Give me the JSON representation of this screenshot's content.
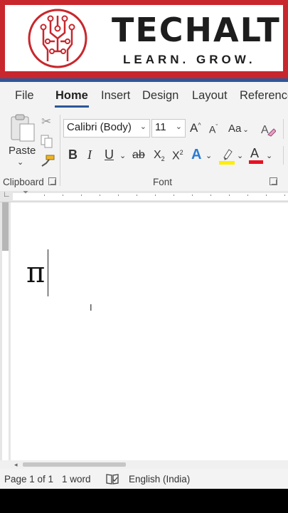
{
  "banner": {
    "brand_name": "TECHALT",
    "tagline": "LEARN. GROW.",
    "logo_icon": "circuit-head-icon",
    "brand_color": "#c8272d"
  },
  "ribbon": {
    "tabs": [
      {
        "label": "File",
        "active": false
      },
      {
        "label": "Home",
        "active": true
      },
      {
        "label": "Insert",
        "active": false
      },
      {
        "label": "Design",
        "active": false
      },
      {
        "label": "Layout",
        "active": false
      },
      {
        "label": "Reference",
        "active": false
      }
    ],
    "clipboard": {
      "paste_label": "Paste",
      "group_label": "Clipboard"
    },
    "font": {
      "font_name": "Calibri (Body)",
      "font_size": "11",
      "group_label": "Font",
      "grow_label": "A",
      "shrink_label": "A",
      "change_case_label": "Aa",
      "bold": "B",
      "italic": "I",
      "underline": "U",
      "strike": "ab",
      "subscript": "X",
      "sub_mark": "2",
      "superscript": "X",
      "sup_mark": "2",
      "effects": "A",
      "highlight_color": "#ffee00",
      "font_color_letter": "A",
      "font_color": "#e81123"
    },
    "accent_color": "#2b579a"
  },
  "document": {
    "content": "π"
  },
  "status": {
    "page": "Page 1 of 1",
    "words": "1 word",
    "language": "English (India)"
  }
}
